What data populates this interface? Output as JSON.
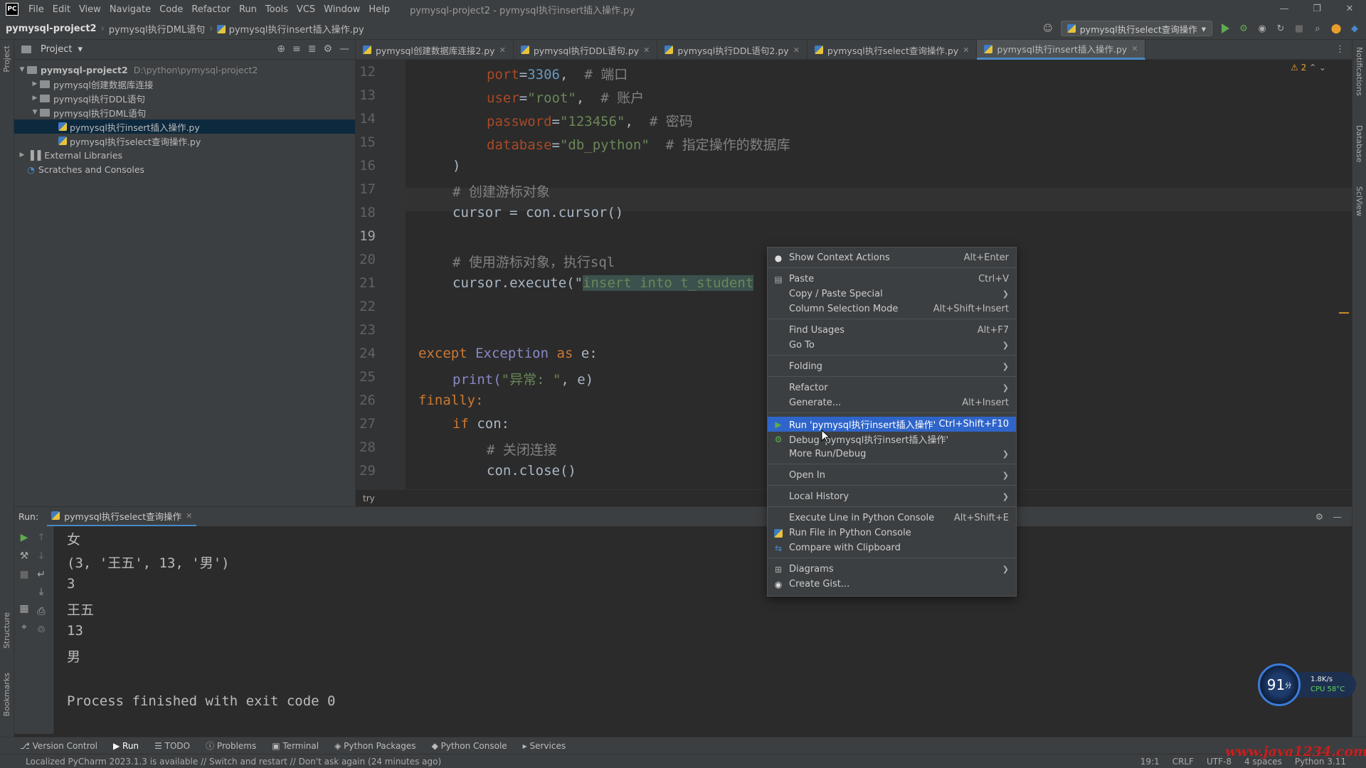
{
  "titlebar": {
    "logo": "PC",
    "menu": [
      "File",
      "Edit",
      "View",
      "Navigate",
      "Code",
      "Refactor",
      "Run",
      "Tools",
      "VCS",
      "Window",
      "Help"
    ],
    "window_title": "pymysql-project2 - pymysql执行insert插入操作.py"
  },
  "navbar": {
    "project": "pymysql-project2",
    "folder": "pymysql执行DML语句",
    "file": "pymysql执行insert插入操作.py",
    "run_config": "pymysql执行select查询操作"
  },
  "project_panel": {
    "title": "Project",
    "root_name": "pymysql-project2",
    "root_path": "D:\\python\\pymysql-project2",
    "folders": [
      "pymysql创建数据库连接",
      "pymysql执行DDL语句",
      "pymysql执行DML语句"
    ],
    "files": [
      "pymysql执行insert插入操作.py",
      "pymysql执行select查询操作.py"
    ],
    "external": "External Libraries",
    "scratches": "Scratches and Consoles"
  },
  "tabs": [
    "pymysql创建数据库连接2.py",
    "pymysql执行DDL语句.py",
    "pymysql执行DDL语句2.py",
    "pymysql执行select查询操作.py",
    "pymysql执行insert插入操作.py"
  ],
  "editor": {
    "warnings": "2",
    "breadcrumb": "try",
    "line_numbers": [
      "12",
      "13",
      "14",
      "15",
      "16",
      "17",
      "18",
      "19",
      "20",
      "21",
      "22",
      "23",
      "24",
      "25",
      "26",
      "27",
      "28",
      "29"
    ],
    "l12": {
      "k": "port",
      "v": "3306",
      "c": "# 端口"
    },
    "l13": {
      "k": "user",
      "v": "\"root\"",
      "c": "# 账户"
    },
    "l14": {
      "k": "password",
      "v": "\"123456\"",
      "c": "# 密码"
    },
    "l15": {
      "k": "database",
      "v": "\"db_python\"",
      "c": "# 指定操作的数据库"
    },
    "l16": ")",
    "l17": "# 创建游标对象",
    "l18": "cursor = con.cursor()",
    "l20": "# 使用游标对象，执行sql",
    "l21_pre": "cursor.execute(\"",
    "l21_hl": "insert into t_student",
    "l24_a": "except",
    "l24_b": "Exception",
    "l24_c": "as",
    "l24_d": "e:",
    "l25_a": "print(",
    "l25_b": "\"异常: \"",
    "l25_c": ", e)",
    "l26": "finally:",
    "l27_a": "if",
    "l27_b": "con:",
    "l28": "# 关闭连接",
    "l29": "con.close()"
  },
  "run_panel": {
    "label": "Run:",
    "tab": "pymysql执行select查询操作",
    "output": [
      "女",
      "(3, '王五', 13, '男')",
      "3",
      "王五",
      "13",
      "男",
      "",
      "Process finished with exit code 0"
    ]
  },
  "context_menu": [
    {
      "label": "Show Context Actions",
      "shortcut": "Alt+Enter",
      "icon": "bulb-icon"
    },
    {
      "label": "Paste",
      "shortcut": "Ctrl+V",
      "icon": "clipboard-icon"
    },
    {
      "label": "Copy / Paste Special",
      "shortcut": "",
      "submenu": true
    },
    {
      "label": "Column Selection Mode",
      "shortcut": "Alt+Shift+Insert"
    },
    {
      "label": "Find Usages",
      "shortcut": "Alt+F7"
    },
    {
      "label": "Go To",
      "shortcut": "",
      "submenu": true
    },
    {
      "label": "Folding",
      "shortcut": "",
      "submenu": true
    },
    {
      "label": "Refactor",
      "shortcut": "",
      "submenu": true
    },
    {
      "label": "Generate...",
      "shortcut": "Alt+Insert"
    },
    {
      "label": "Run 'pymysql执行insert插入操作'",
      "shortcut": "Ctrl+Shift+F10",
      "icon": "run-icon",
      "selected": true
    },
    {
      "label": "Debug 'pymysql执行insert插入操作'",
      "shortcut": "",
      "icon": "debug-icon"
    },
    {
      "label": "More Run/Debug",
      "shortcut": "",
      "submenu": true
    },
    {
      "label": "Open In",
      "shortcut": "",
      "submenu": true
    },
    {
      "label": "Local History",
      "shortcut": "",
      "submenu": true
    },
    {
      "label": "Execute Line in Python Console",
      "shortcut": "Alt+Shift+E"
    },
    {
      "label": "Run File in Python Console",
      "shortcut": "",
      "icon": "python-icon"
    },
    {
      "label": "Compare with Clipboard",
      "shortcut": "",
      "icon": "compare-icon"
    },
    {
      "label": "Diagrams",
      "shortcut": "",
      "submenu": true,
      "icon": "diagram-icon"
    },
    {
      "label": "Create Gist...",
      "shortcut": "",
      "icon": "github-icon"
    }
  ],
  "bottom_tools": [
    "Version Control",
    "Run",
    "TODO",
    "Problems",
    "Terminal",
    "Python Packages",
    "Python Console",
    "Services"
  ],
  "status": {
    "message": "Localized PyCharm 2023.1.3 is available // Switch and restart // Don't ask again (24 minutes ago)",
    "position": "19:1",
    "line_sep": "CRLF",
    "encoding": "UTF-8",
    "indent": "4 spaces",
    "interpreter": "Python 3.11"
  },
  "side_labels": {
    "project": "Project",
    "structure": "Structure",
    "bookmarks": "Bookmarks",
    "notifications": "Notifications",
    "database": "Database",
    "sciview": "SciView"
  },
  "widget": {
    "score": "91",
    "unit": "分",
    "net": "1.8K/s",
    "cpu": "CPU 58°C"
  },
  "watermark": "www.java1234.com"
}
